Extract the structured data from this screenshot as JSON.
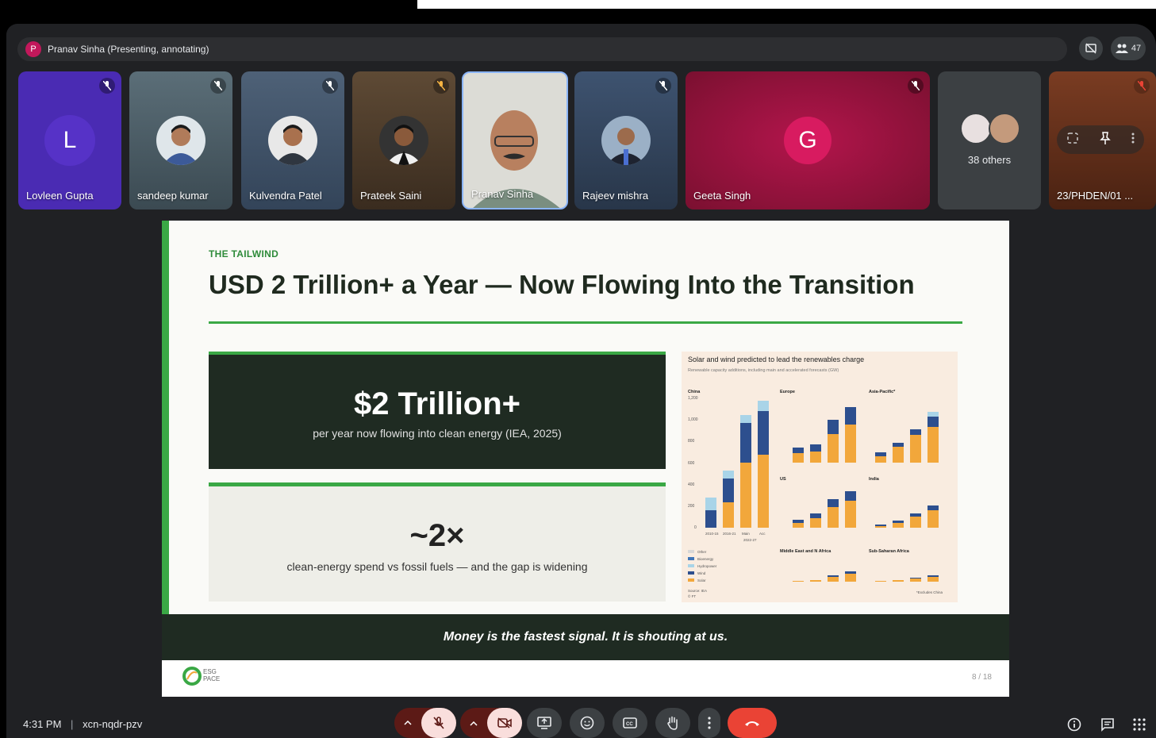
{
  "presenter": {
    "avatar_letter": "P",
    "label": "Pranav Sinha (Presenting, annotating)"
  },
  "top_right": {
    "participant_count": "47"
  },
  "tiles": [
    {
      "name": "Lovleen Gupta",
      "letter": "L"
    },
    {
      "name": "sandeep kumar"
    },
    {
      "name": "Kulvendra Patel"
    },
    {
      "name": "Prateek Saini"
    },
    {
      "name": "Pranav Sinha"
    },
    {
      "name": "Rajeev mishra"
    },
    {
      "name": "Geeta Singh",
      "letter": "G"
    },
    {
      "name": "38 others"
    },
    {
      "name": "23/PHDEN/01 ..."
    }
  ],
  "slide": {
    "kicker": "THE TAILWIND",
    "title": "USD 2 Trillion+ a Year — Now Flowing Into the Transition",
    "stat1": {
      "value": "$2 Trillion+",
      "caption": "per year now flowing into clean energy (IEA, 2025)"
    },
    "stat2": {
      "value": "~2×",
      "caption": "clean-energy spend vs fossil fuels — and the gap is widening"
    },
    "quote": "Money is the fastest signal. It is shouting at us.",
    "logo_text": "ESG PACE",
    "page": "8 / 18",
    "chart": {
      "title": "Solar and wind predicted to lead the renewables charge",
      "subtitle": "Renewable capacity additions, including main and accelerated forecasts (GW)",
      "panels": [
        "China",
        "Europe",
        "Asia-Pacific*",
        "US",
        "India",
        "Middle East and N Africa",
        "Sub-Saharan Africa"
      ],
      "china_x": [
        "2010-15",
        "2016-21",
        "Main",
        "Acc"
      ],
      "china_x2": "2022-27",
      "legend": [
        "Other",
        "Bioenergy",
        "Hydropower",
        "Wind",
        "Solar"
      ],
      "source": "Source: IEA",
      "ft": "© FT",
      "note": "*Excludes China",
      "china_yticks": [
        "1,200",
        "1,000",
        "800",
        "600",
        "400",
        "200",
        "0"
      ]
    }
  },
  "bottom": {
    "time": "4:31 PM",
    "separator": "|",
    "code": "xcn-nqdr-pzv"
  },
  "colors": {
    "solar": "#f2a73b",
    "wind": "#2d4f8e",
    "hydro": "#a9d4e8",
    "bio": "#3f75b8",
    "other": "#d7d7d7",
    "accent": "#3aa845"
  }
}
